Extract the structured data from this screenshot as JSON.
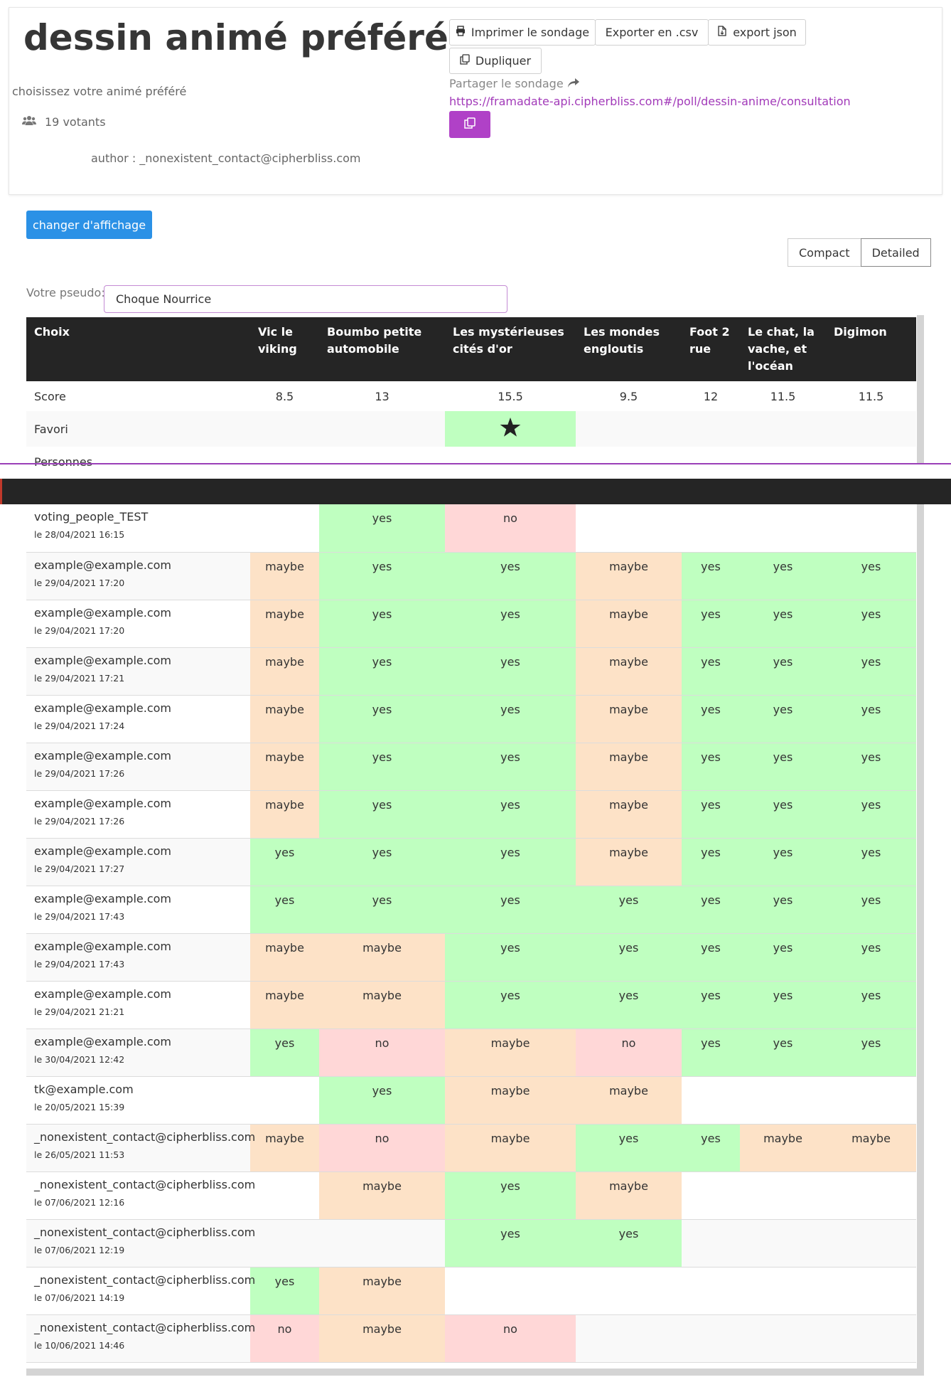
{
  "poll": {
    "title": "dessin animé préféré",
    "description": "choisissez votre animé préféré",
    "voters": "19 votants",
    "author": "author : _nonexistent_contact@cipherbliss.com"
  },
  "actions": {
    "print": "Imprimer le sondage",
    "csv": "Exporter en .csv",
    "json": "export json",
    "duplicate": "Dupliquer",
    "share_label": "Partager le sondage",
    "share_url": "https://framadate-api.cipherbliss.com#/poll/dessin-anime/consultation"
  },
  "display": {
    "change_button": "changer d'affichage",
    "compact": "Compact",
    "detailed": "Detailed",
    "active_view": "Detailed"
  },
  "pseudo": {
    "label": "Votre pseudo:",
    "value": "Choque Nourrice"
  },
  "colors": {
    "yes": "#bfffc0",
    "maybe": "#fde2c7",
    "no": "#ffd7d7",
    "header": "#252525",
    "accent": "#b041c7",
    "primary": "#2b91e6"
  },
  "table": {
    "header_label": "Choix",
    "choices": [
      "Vic le viking",
      "Boumbo petite automobile",
      "Les mystérieuses cités d'or",
      "Les mondes engloutis",
      "Foot 2 rue",
      "Le chat, la vache, et l'océan",
      "Digimon"
    ],
    "score_label": "Score",
    "scores": [
      "8.5",
      "13",
      "15.5",
      "9.5",
      "12",
      "11.5",
      "11.5"
    ],
    "favorite_label": "Favori",
    "favorite_index": 2,
    "people_label": "Personnes",
    "voters": [
      {
        "name": "voting_people_TEST",
        "date": "le 28/04/2021 16:15",
        "votes": [
          "",
          "yes",
          "no",
          "",
          "",
          "",
          ""
        ]
      },
      {
        "name": "example@example.com",
        "date": "le 29/04/2021 17:20",
        "votes": [
          "maybe",
          "yes",
          "yes",
          "maybe",
          "yes",
          "yes",
          "yes"
        ]
      },
      {
        "name": "example@example.com",
        "date": "le 29/04/2021 17:20",
        "votes": [
          "maybe",
          "yes",
          "yes",
          "maybe",
          "yes",
          "yes",
          "yes"
        ]
      },
      {
        "name": "example@example.com",
        "date": "le 29/04/2021 17:21",
        "votes": [
          "maybe",
          "yes",
          "yes",
          "maybe",
          "yes",
          "yes",
          "yes"
        ]
      },
      {
        "name": "example@example.com",
        "date": "le 29/04/2021 17:24",
        "votes": [
          "maybe",
          "yes",
          "yes",
          "maybe",
          "yes",
          "yes",
          "yes"
        ]
      },
      {
        "name": "example@example.com",
        "date": "le 29/04/2021 17:26",
        "votes": [
          "maybe",
          "yes",
          "yes",
          "maybe",
          "yes",
          "yes",
          "yes"
        ]
      },
      {
        "name": "example@example.com",
        "date": "le 29/04/2021 17:26",
        "votes": [
          "maybe",
          "yes",
          "yes",
          "maybe",
          "yes",
          "yes",
          "yes"
        ]
      },
      {
        "name": "example@example.com",
        "date": "le 29/04/2021 17:27",
        "votes": [
          "yes",
          "yes",
          "yes",
          "maybe",
          "yes",
          "yes",
          "yes"
        ]
      },
      {
        "name": "example@example.com",
        "date": "le 29/04/2021 17:43",
        "votes": [
          "yes",
          "yes",
          "yes",
          "yes",
          "yes",
          "yes",
          "yes"
        ]
      },
      {
        "name": "example@example.com",
        "date": "le 29/04/2021 17:43",
        "votes": [
          "maybe",
          "maybe",
          "yes",
          "yes",
          "yes",
          "yes",
          "yes"
        ]
      },
      {
        "name": "example@example.com",
        "date": "le 29/04/2021 21:21",
        "votes": [
          "maybe",
          "maybe",
          "yes",
          "yes",
          "yes",
          "yes",
          "yes"
        ]
      },
      {
        "name": "example@example.com",
        "date": "le 30/04/2021 12:42",
        "votes": [
          "yes",
          "no",
          "maybe",
          "no",
          "yes",
          "yes",
          "yes"
        ]
      },
      {
        "name": "tk@example.com",
        "date": "le 20/05/2021 15:39",
        "votes": [
          "",
          "yes",
          "maybe",
          "maybe",
          "",
          "",
          ""
        ]
      },
      {
        "name": "_nonexistent_contact@cipherbliss.com",
        "date": "le 26/05/2021 11:53",
        "votes": [
          "maybe",
          "no",
          "maybe",
          "yes",
          "yes",
          "maybe",
          "maybe"
        ]
      },
      {
        "name": "_nonexistent_contact@cipherbliss.com",
        "date": "le 07/06/2021 12:16",
        "votes": [
          "",
          "maybe",
          "yes",
          "maybe",
          "",
          "",
          ""
        ]
      },
      {
        "name": "_nonexistent_contact@cipherbliss.com",
        "date": "le 07/06/2021 12:19",
        "votes": [
          "",
          "",
          "yes",
          "yes",
          "",
          "",
          ""
        ]
      },
      {
        "name": "_nonexistent_contact@cipherbliss.com",
        "date": "le 07/06/2021 14:19",
        "votes": [
          "yes",
          "maybe",
          "",
          "",
          "",
          "",
          ""
        ]
      },
      {
        "name": "_nonexistent_contact@cipherbliss.com",
        "date": "le 10/06/2021 14:46",
        "votes": [
          "no",
          "maybe",
          "no",
          "",
          "",
          "",
          ""
        ]
      }
    ]
  }
}
